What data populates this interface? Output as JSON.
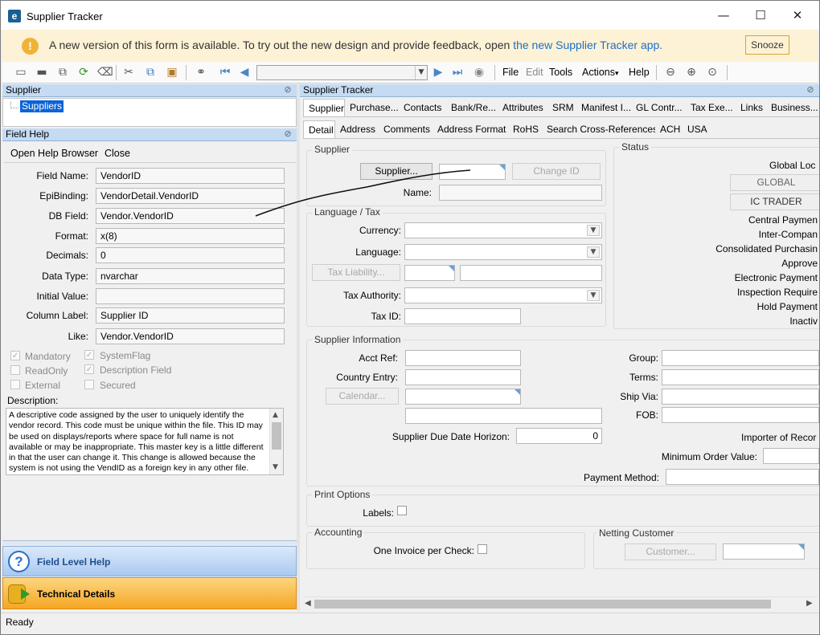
{
  "window": {
    "title": "Supplier Tracker",
    "minimize": "—",
    "maximize": "☐",
    "close": "✕"
  },
  "banner": {
    "icon": "!",
    "text": "A new version of this form is available. To try out the new design and provide feedback, open ",
    "link": "the new Supplier Tracker app.",
    "snooze": "Snooze"
  },
  "menu": {
    "file": "File",
    "edit": "Edit",
    "tools": "Tools",
    "actions": "Actions",
    "actions_arrow": "▾",
    "help": "Help"
  },
  "icons": {
    "toolbar": [
      "book-icon",
      "folder-icon",
      "clip-icon",
      "refresh-icon",
      "eraser-icon",
      "cut-icon",
      "copy-icon",
      "paste-icon",
      "binoculars-icon",
      "first-icon",
      "prev-icon",
      "next-icon",
      "last-icon",
      "stop-icon",
      "back-circle-icon",
      "forward-circle-icon",
      "home-circle-icon"
    ]
  },
  "left": {
    "supplier_header": "Supplier",
    "tree_item": "Suppliers",
    "fieldhelp_header": "Field Help",
    "open_help_browser": "Open Help Browser",
    "close": "Close",
    "fields": {
      "field_name_label": "Field Name:",
      "field_name": "VendorID",
      "epibinding_label": "EpiBinding:",
      "epibinding": "VendorDetail.VendorID",
      "dbfield_label": "DB Field:",
      "dbfield": "Vendor.VendorID",
      "format_label": "Format:",
      "format": "x(8)",
      "decimals_label": "Decimals:",
      "decimals": "0",
      "datatype_label": "Data Type:",
      "datatype": "nvarchar",
      "initial_label": "Initial Value:",
      "initial": "",
      "column_label_label": "Column Label:",
      "column_label": "Supplier ID",
      "like_label": "Like:",
      "like": "Vendor.VendorID"
    },
    "flags": {
      "mandatory": "Mandatory",
      "systemflag": "SystemFlag",
      "readonly": "ReadOnly",
      "descfield": "Description Field",
      "external": "External",
      "secured": "Secured"
    },
    "description_label": "Description:",
    "description": "A descriptive code assigned by the user to uniquely identify the vendor record.  This code must be unique within the file.  This ID may be used on displays/reports where space for full name is not available or may be inappropriate. This master key is a little different in that the user can change it.  This change is allowed because the system is not using the VendID as a foreign key in any other file.",
    "field_level_help": "Field Level Help",
    "technical_details": "Technical Details"
  },
  "right": {
    "header": "Supplier Tracker",
    "tabs1": [
      "Supplier",
      "Purchase...",
      "Contacts",
      "Bank/Re...",
      "Attributes",
      "SRM",
      "Manifest I...",
      "GL Contr...",
      "Tax Exe...",
      "Links",
      "Business..."
    ],
    "tabs2": [
      "Detail",
      "Address",
      "Comments",
      "Address Format",
      "RoHS",
      "Search Cross-References",
      "ACH",
      "USA"
    ],
    "supplier_group": "Supplier",
    "supplier_btn": "Supplier...",
    "change_id": "Change ID",
    "name_label": "Name:",
    "status_group": "Status",
    "global_lock": "Global Loc",
    "global_btn": "GLOBAL",
    "ic_trader": "IC TRADER",
    "status_items": [
      "Central Paymen",
      "Inter-Compan",
      "Consolidated Purchasin",
      "Approve",
      "Electronic Payment",
      "Inspection Require",
      "Hold Payment",
      "Inactiv"
    ],
    "langtax_group": "Language / Tax",
    "currency_label": "Currency:",
    "language_label": "Language:",
    "tax_liability": "Tax Liability...",
    "tax_authority_label": "Tax Authority:",
    "tax_id_label": "Tax ID:",
    "supinfo_group": "Supplier Information",
    "acct_ref_label": "Acct Ref:",
    "country_entry_label": "Country Entry:",
    "calendar_btn": "Calendar...",
    "due_horizon_label": "Supplier Due Date Horizon:",
    "due_horizon": "0",
    "group_label": "Group:",
    "terms_label": "Terms:",
    "shipvia_label": "Ship Via:",
    "fob_label": "FOB:",
    "importer_label": "Importer of Recor",
    "min_order_label": "Minimum Order Value:",
    "payment_method_label": "Payment Method:",
    "print_group": "Print Options",
    "labels_label": "Labels:",
    "accounting_group": "Accounting",
    "one_invoice_label": "One Invoice per Check:",
    "netting_group": "Netting Customer",
    "customer_btn": "Customer..."
  },
  "status": {
    "text": "Ready"
  }
}
